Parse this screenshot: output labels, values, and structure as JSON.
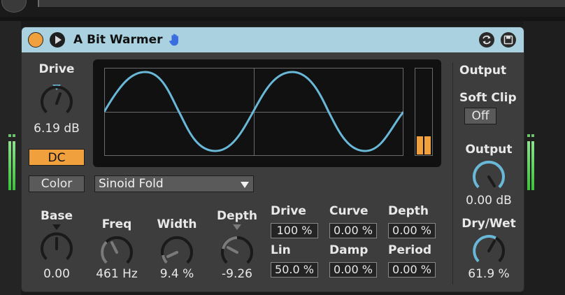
{
  "device": {
    "title": "A Bit Warmer",
    "power_on": true,
    "icons": {
      "power": "power-toggle-icon",
      "play": "play-icon",
      "hand": "hand-icon",
      "swap": "swap-icon",
      "save": "save-preset-icon"
    }
  },
  "left": {
    "drive_label": "Drive",
    "drive_value": "6.19 dB",
    "dc_label": "DC",
    "color_label": "Color"
  },
  "mode": {
    "selected": "Sinoid Fold"
  },
  "knobs": {
    "base_label": "Base",
    "base_value": "0.00",
    "freq_label": "Freq",
    "freq_value": "461 Hz",
    "width_label": "Width",
    "width_value": "9.4 %",
    "depth_label": "Depth",
    "depth_value": "-9.26"
  },
  "shaper": {
    "drive_label": "Drive",
    "drive_value": "100 %",
    "curve_label": "Curve",
    "curve_value": "0.00 %",
    "depth_label": "Depth",
    "depth_value": "0.00 %",
    "lin_label": "Lin",
    "lin_value": "50.0 %",
    "damp_label": "Damp",
    "damp_value": "0.00 %",
    "period_label": "Period",
    "period_value": "0.00 %"
  },
  "output": {
    "section_label": "Output",
    "softclip_label": "Soft Clip",
    "softclip_value": "Off",
    "output_label": "Output",
    "output_value": "0.00 dB",
    "drywet_label": "Dry/Wet",
    "drywet_value": "61.9 %"
  },
  "colors": {
    "accent_orange": "#f0a03c",
    "wave_blue": "#6ab8d8",
    "titlebar": "#a9d1df",
    "panel": "#3d3d3d"
  }
}
